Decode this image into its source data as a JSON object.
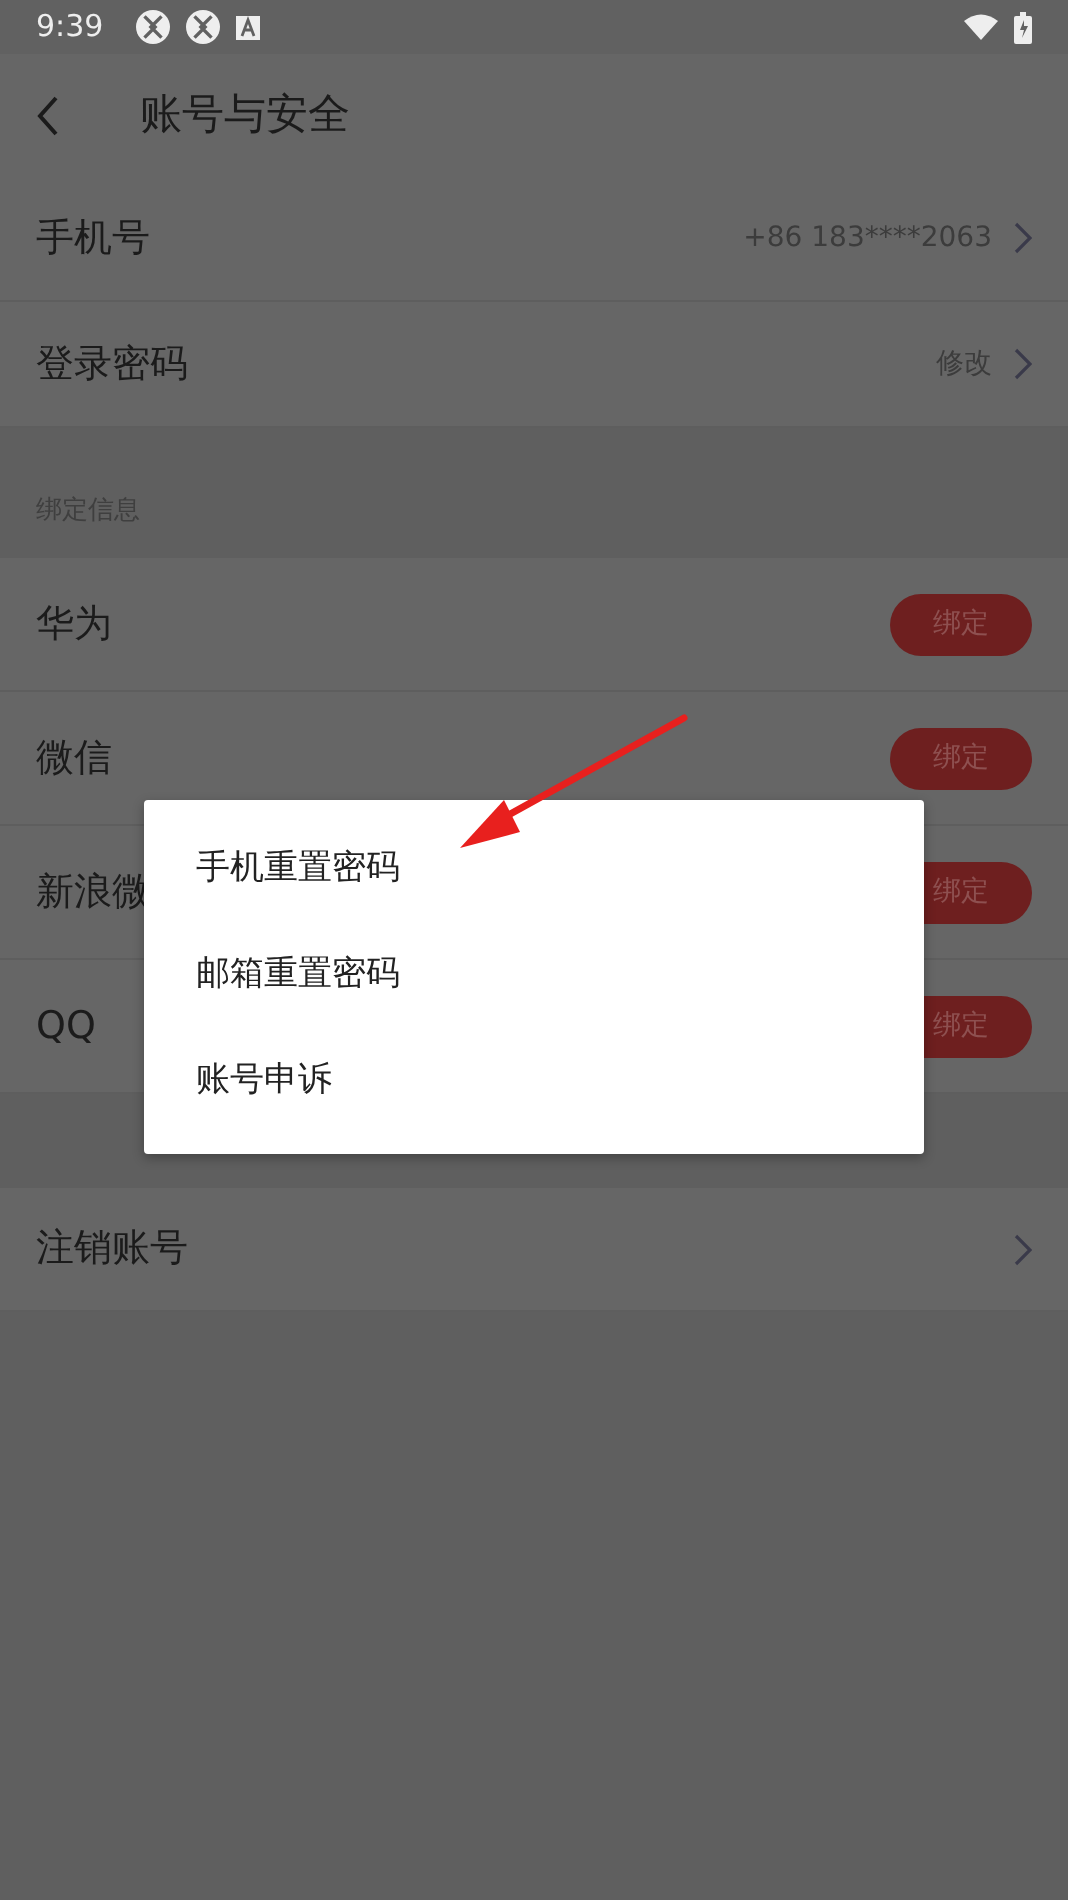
{
  "status_bar": {
    "time": "9:39"
  },
  "header": {
    "title": "账号与安全"
  },
  "account_rows": [
    {
      "label": "手机号",
      "value": "+86 183****2063"
    },
    {
      "label": "登录密码",
      "value": "修改"
    }
  ],
  "binding_section": {
    "title": "绑定信息",
    "items": [
      {
        "label": "华为",
        "button": "绑定"
      },
      {
        "label": "微信",
        "button": "绑定"
      },
      {
        "label": "新浪微",
        "button": "绑定"
      },
      {
        "label": "QQ",
        "button": "绑定"
      }
    ]
  },
  "bottom_rows": [
    {
      "label": "注销账号"
    }
  ],
  "popup_menu": {
    "items": [
      "手机重置密码",
      "邮箱重置密码",
      "账号申诉"
    ]
  }
}
